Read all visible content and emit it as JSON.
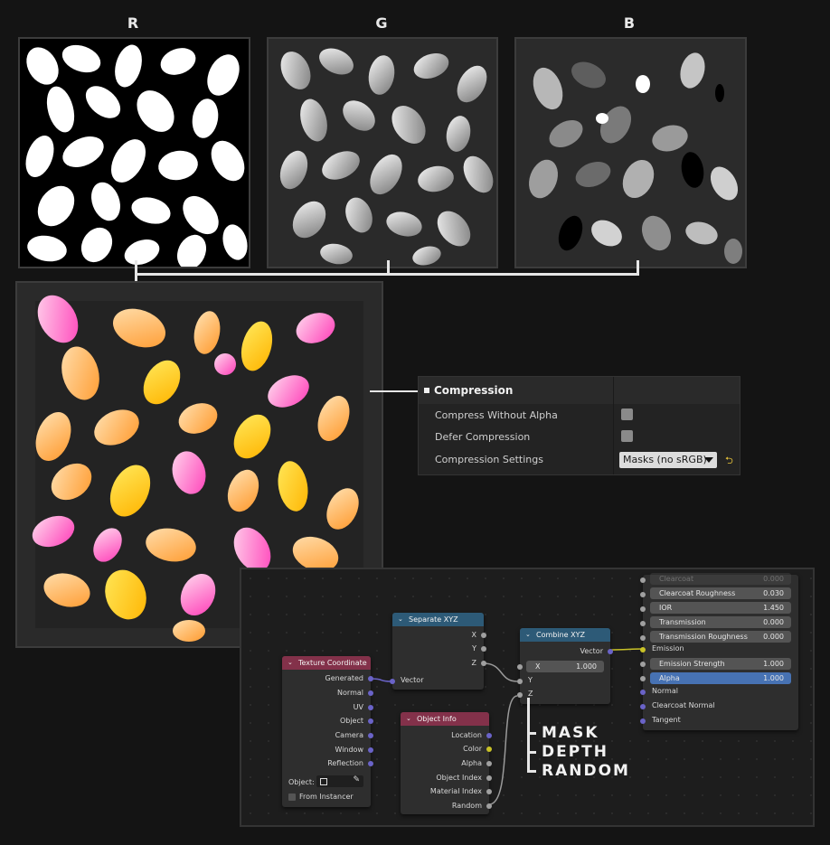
{
  "channels": {
    "r_label": "R",
    "g_label": "G",
    "b_label": "B"
  },
  "compression": {
    "title": "Compression",
    "compress_without_alpha": "Compress Without Alpha",
    "defer_compression": "Defer Compression",
    "compression_settings": "Compression Settings",
    "settings_value": "Masks (no sRGB)",
    "reset_symbol": "⮌"
  },
  "nodes": {
    "texcoord": {
      "title": "Texture Coordinate",
      "outputs": [
        "Generated",
        "Normal",
        "UV",
        "Object",
        "Camera",
        "Window",
        "Reflection"
      ],
      "object_label": "Object:",
      "from_instancer": "From Instancer"
    },
    "separate": {
      "title": "Separate XYZ",
      "outputs": [
        "X",
        "Y",
        "Z"
      ],
      "input": "Vector"
    },
    "objinfo": {
      "title": "Object Info",
      "outputs": [
        "Location",
        "Color",
        "Alpha",
        "Object Index",
        "Material Index",
        "Random"
      ]
    },
    "combine": {
      "title": "Combine XYZ",
      "output": "Vector",
      "x_label": "X",
      "x_value": "1.000",
      "y_label": "Y",
      "z_label": "Z"
    },
    "bsdf": {
      "top_fields": [
        {
          "label": "Clearcoat",
          "value": "0.000"
        },
        {
          "label": "Clearcoat Roughness",
          "value": "0.030"
        },
        {
          "label": "IOR",
          "value": "1.450"
        },
        {
          "label": "Transmission",
          "value": "0.000"
        },
        {
          "label": "Transmission Roughness",
          "value": "0.000"
        }
      ],
      "emission": "Emission",
      "emission_strength": {
        "label": "Emission Strength",
        "value": "1.000"
      },
      "alpha": {
        "label": "Alpha",
        "value": "1.000"
      },
      "normal": "Normal",
      "clearcoat_normal": "Clearcoat Normal",
      "tangent": "Tangent"
    }
  },
  "annotations": {
    "mask": "MASK",
    "depth": "DEPTH",
    "random": "RANDOM"
  },
  "colors": {
    "accent_emission": "#c9c227",
    "vector_socket": "#6a63c8",
    "alpha_field": "#4772b3"
  }
}
